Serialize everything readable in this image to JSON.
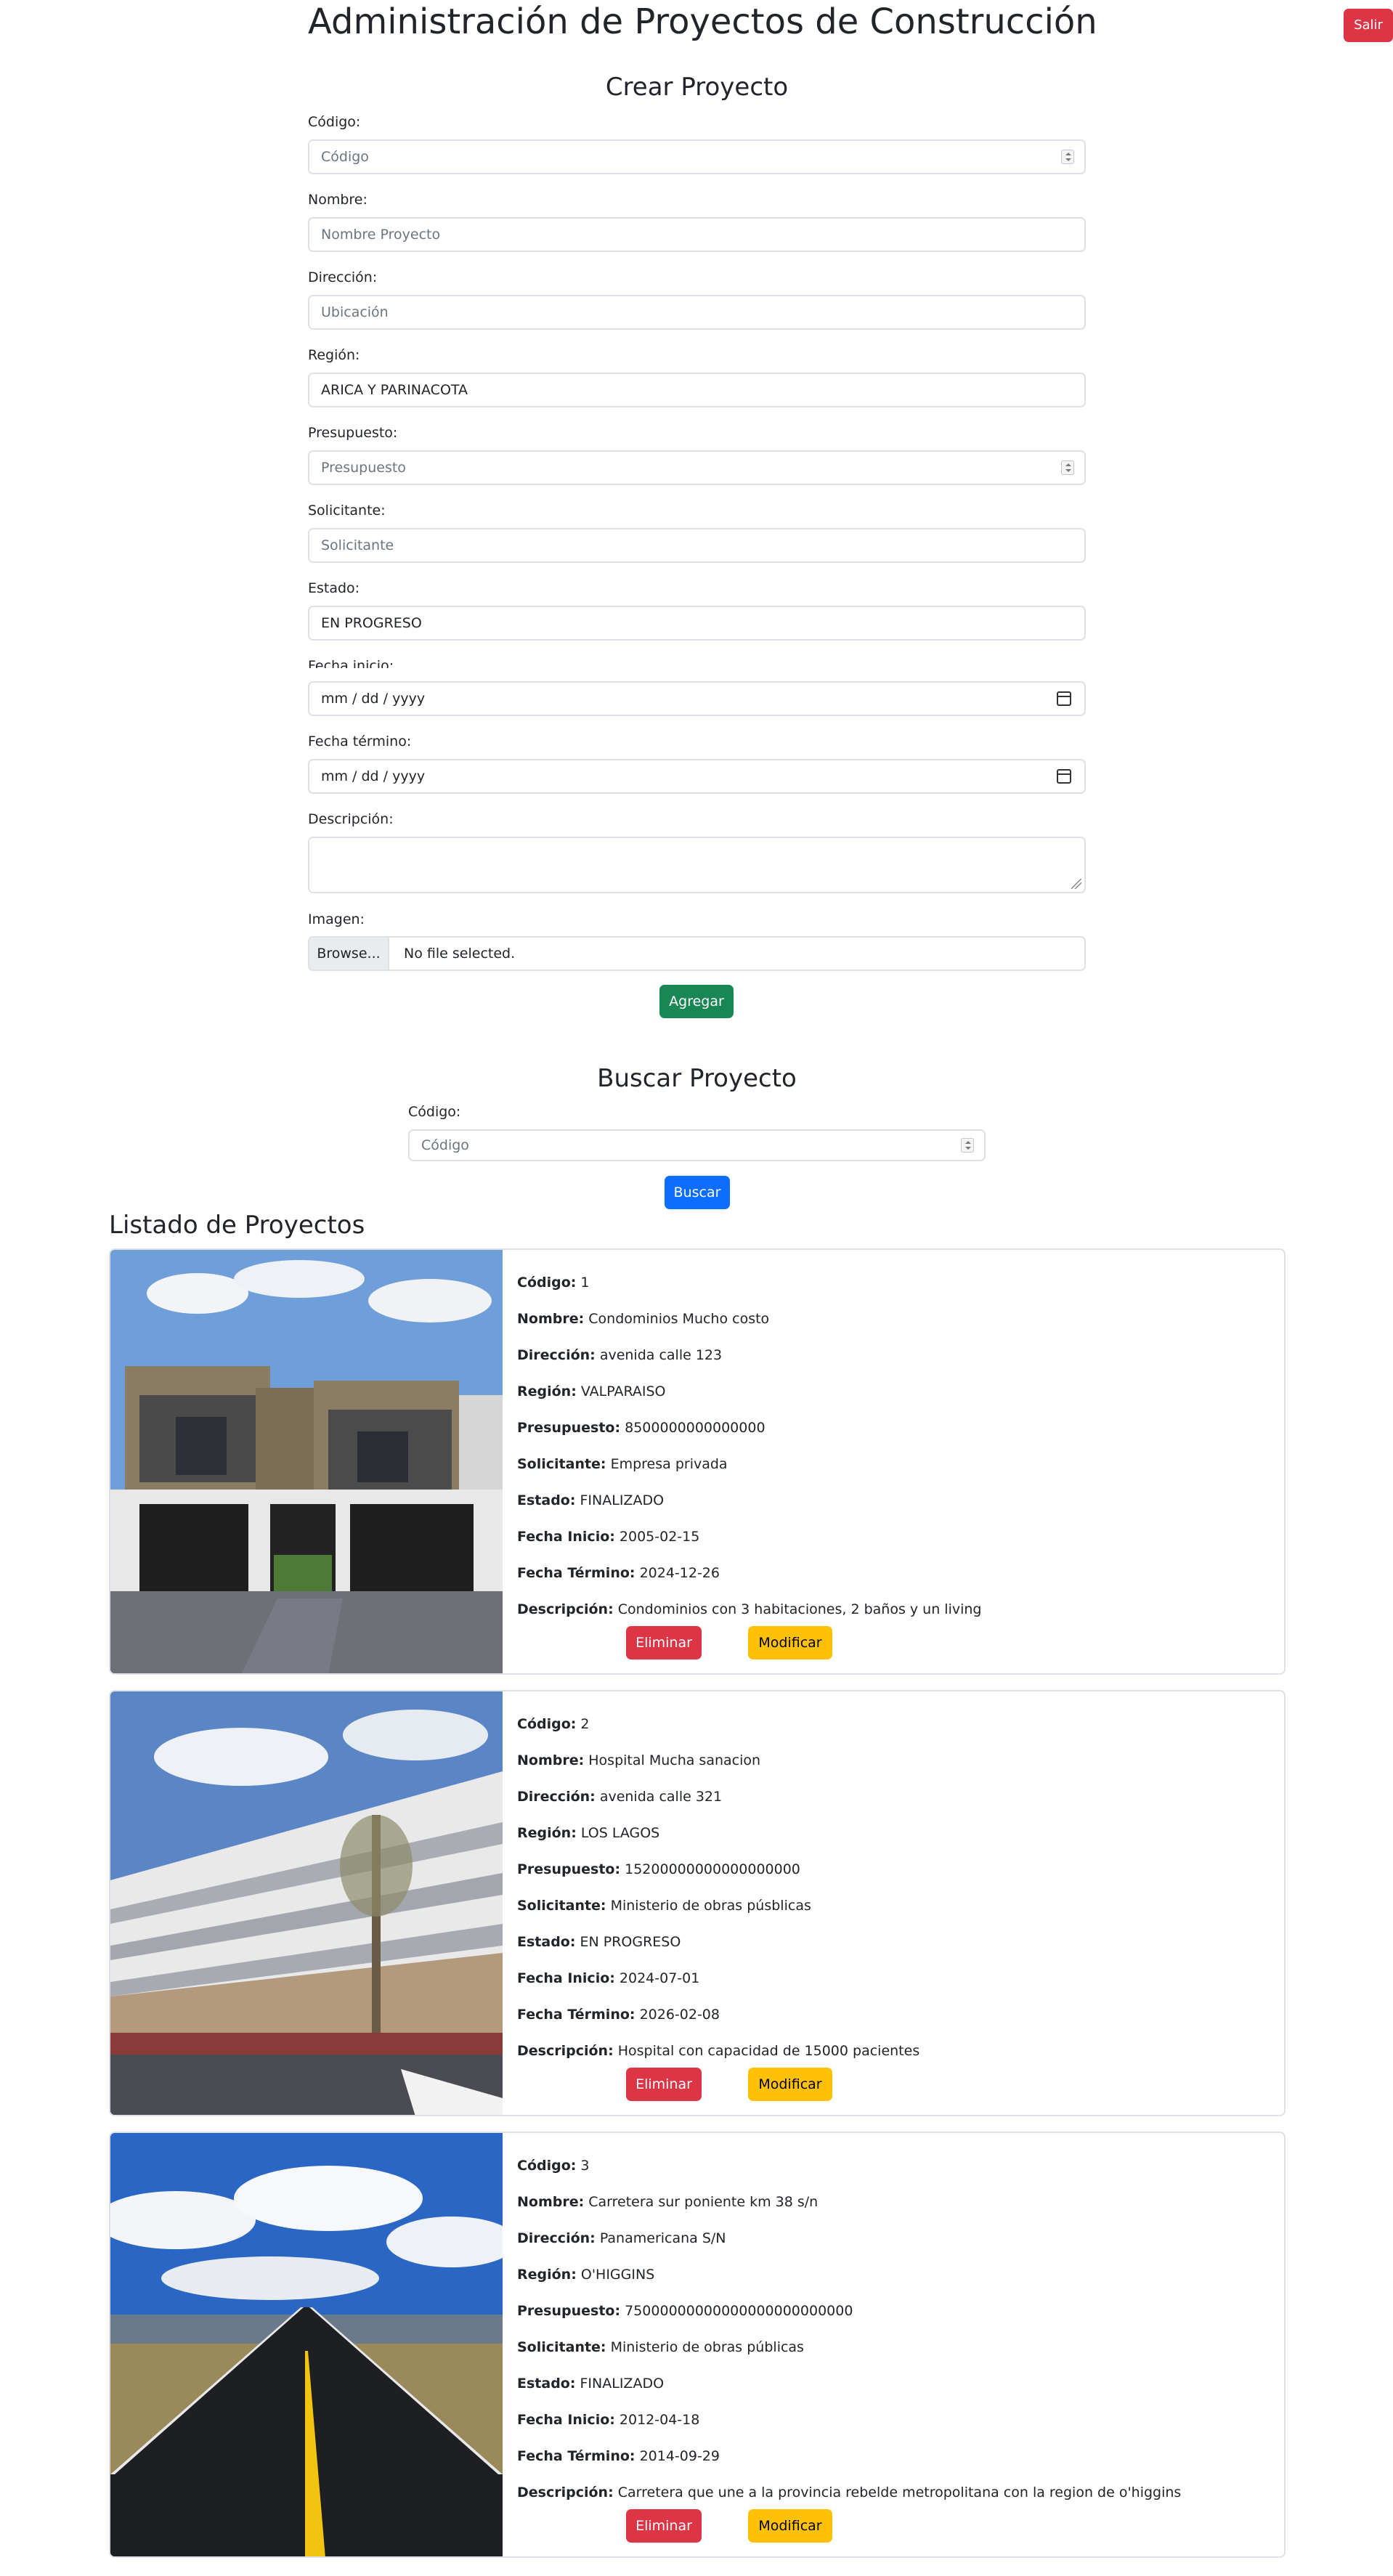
{
  "header": {
    "title": "Administración de Proyectos de Construcción",
    "logout_label": "Salir"
  },
  "create": {
    "title": "Crear Proyecto",
    "fields": {
      "codigo": {
        "label": "Código:",
        "placeholder": "Código"
      },
      "nombre": {
        "label": "Nombre:",
        "placeholder": "Nombre Proyecto"
      },
      "direccion": {
        "label": "Dirección:",
        "placeholder": "Ubicación"
      },
      "region": {
        "label": "Región:",
        "value": "ARICA Y PARINACOTA"
      },
      "presupuesto": {
        "label": "Presupuesto:",
        "placeholder": "Presupuesto"
      },
      "solicitante": {
        "label": "Solicitante:",
        "placeholder": "Solicitante"
      },
      "estado": {
        "label": "Estado:",
        "value": "EN PROGRESO"
      },
      "fecha_inicio": {
        "label": "Fecha inicio:",
        "value": "mm / dd / yyyy"
      },
      "fecha_termino": {
        "label": "Fecha término:",
        "value": "mm / dd / yyyy"
      },
      "descripcion": {
        "label": "Descripción:"
      },
      "imagen": {
        "label": "Imagen:",
        "browse": "Browse...",
        "status": "No file selected."
      }
    },
    "submit_label": "Agregar"
  },
  "search": {
    "title": "Buscar Proyecto",
    "label": "Código:",
    "placeholder": "Código",
    "button_label": "Buscar"
  },
  "list": {
    "title": "Listado de Proyectos",
    "labels": {
      "codigo": "Código:",
      "nombre": "Nombre:",
      "direccion": "Dirección:",
      "region": "Región:",
      "presupuesto": "Presupuesto:",
      "solicitante": "Solicitante:",
      "estado": "Estado:",
      "fecha_inicio": "Fecha Inicio:",
      "fecha_termino": "Fecha Término:",
      "descripcion": "Descripción:"
    },
    "delete_label": "Eliminar",
    "modify_label": "Modificar",
    "projects": [
      {
        "codigo": "1",
        "nombre": "Condominios Mucho costo",
        "direccion": "avenida calle 123",
        "region": "VALPARAISO",
        "presupuesto": "8500000000000000",
        "solicitante": "Empresa privada",
        "estado": "FINALIZADO",
        "fecha_inicio": "2005-02-15",
        "fecha_termino": "2024-12-26",
        "descripcion": "Condominios con 3 habitaciones, 2 baños y un living"
      },
      {
        "codigo": "2",
        "nombre": "Hospital Mucha sanacion",
        "direccion": "avenida calle 321",
        "region": "LOS LAGOS",
        "presupuesto": "15200000000000000000",
        "solicitante": "Ministerio de obras púsblicas",
        "estado": "EN PROGRESO",
        "fecha_inicio": "2024-07-01",
        "fecha_termino": "2026-02-08",
        "descripcion": "Hospital con capacidad de 15000 pacientes"
      },
      {
        "codigo": "3",
        "nombre": "Carretera sur poniente km 38 s/n",
        "direccion": "Panamericana S/N",
        "region": "O'HIGGINS",
        "presupuesto": "75000000000000000000000000",
        "solicitante": "Ministerio de obras públicas",
        "estado": "FINALIZADO",
        "fecha_inicio": "2012-04-18",
        "fecha_termino": "2014-09-29",
        "descripcion": "Carretera que une a la provincia rebelde metropolitana con la region de o'higgins"
      }
    ]
  },
  "colors": {
    "danger": "#dc3545",
    "success": "#198754",
    "primary": "#0d6efd",
    "warning": "#ffc107"
  }
}
